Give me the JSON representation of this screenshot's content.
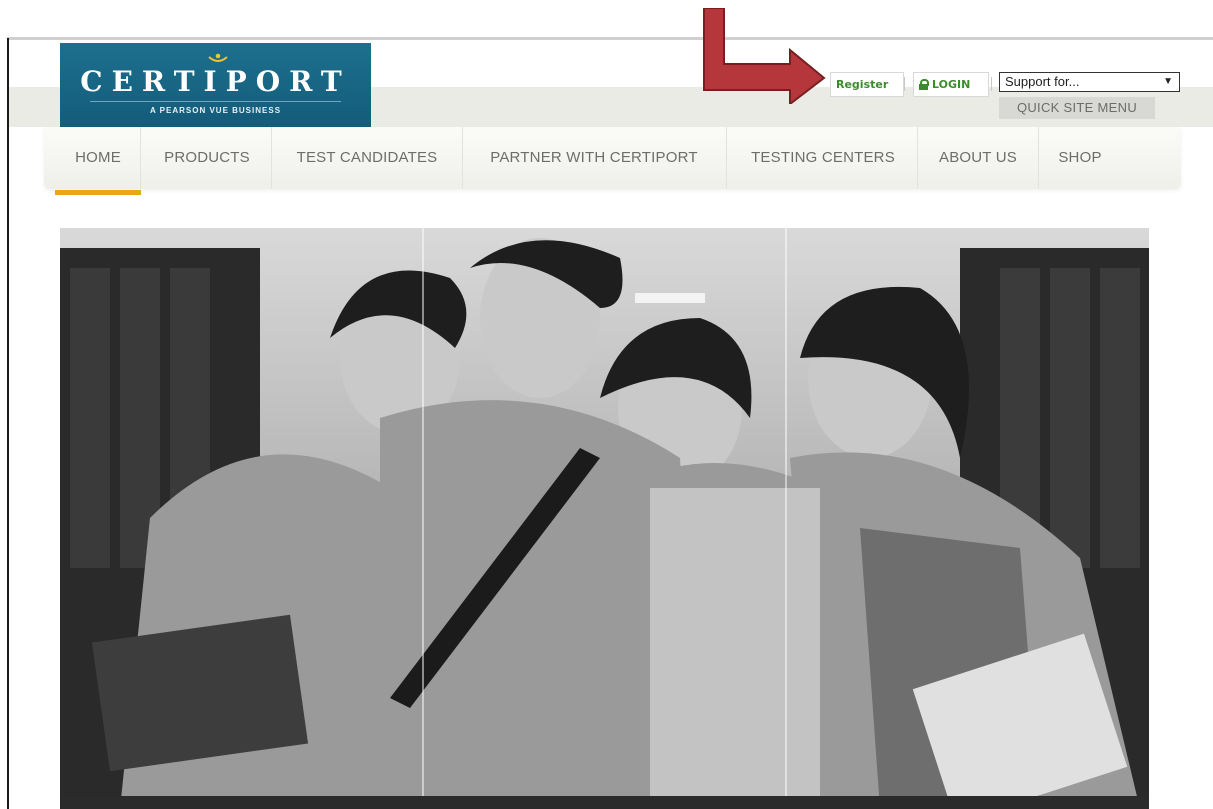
{
  "logo": {
    "name": "CERTIPORT",
    "tagline": "A PEARSON VUE BUSINESS"
  },
  "header": {
    "register_label": "Register",
    "login_label": "LOGIN",
    "support_select": {
      "selected": "Support for..."
    },
    "quick_menu_label": "QUICK SITE MENU"
  },
  "nav": {
    "items": [
      {
        "label": "HOME",
        "active": true
      },
      {
        "label": "PRODUCTS"
      },
      {
        "label": "TEST CANDIDATES"
      },
      {
        "label": "PARTNER WITH CERTIPORT"
      },
      {
        "label": "TESTING CENTERS"
      },
      {
        "label": "ABOUT US"
      },
      {
        "label": "SHOP"
      }
    ]
  },
  "colors": {
    "brand_blue": "#135c7a",
    "link_green": "#3b8c2c",
    "active_underline": "#e6a817",
    "annotation_arrow": "#b5373b"
  },
  "icons": {
    "login": "lock-icon",
    "select": "caret-down-icon",
    "annotation": "red-arrow-icon"
  }
}
